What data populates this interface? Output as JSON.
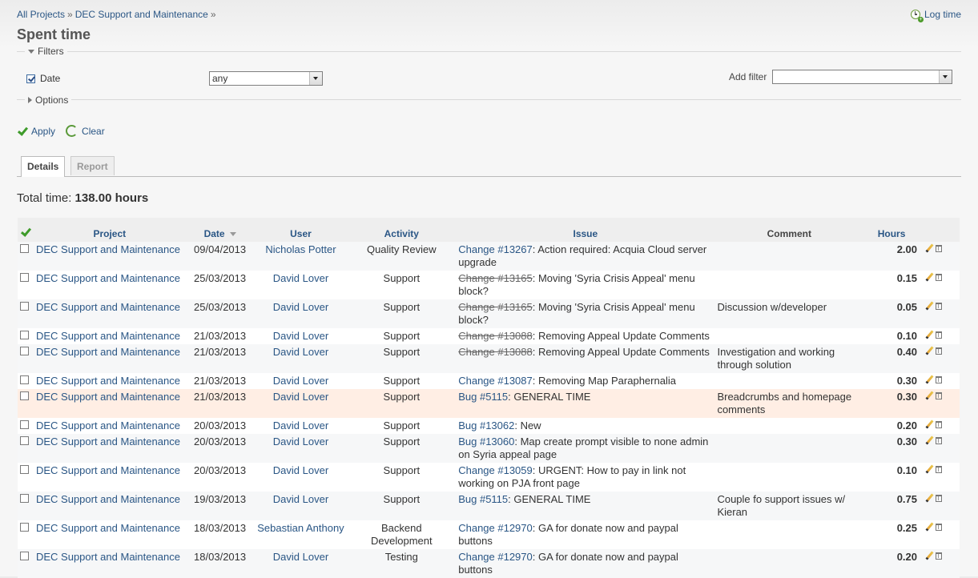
{
  "breadcrumb": {
    "all_projects": "All Projects",
    "project": "DEC Support and Maintenance",
    "sep": "»"
  },
  "log_time": "Log time",
  "title": "Spent time",
  "filters": {
    "legend": "Filters",
    "date_label": "Date",
    "date_value": "any",
    "add_filter_label": "Add filter",
    "add_filter_value": ""
  },
  "options": {
    "legend": "Options"
  },
  "actions": {
    "apply": "Apply",
    "clear": "Clear"
  },
  "tabs": {
    "details": "Details",
    "report": "Report"
  },
  "total": {
    "label": "Total time:",
    "value": "138.00 hours"
  },
  "table": {
    "headers": {
      "project": "Project",
      "date": "Date",
      "user": "User",
      "activity": "Activity",
      "issue": "Issue",
      "comment": "Comment",
      "hours": "Hours"
    },
    "rows": [
      {
        "project": "DEC Support and Maintenance",
        "date": "09/04/2013",
        "user": "Nicholas Potter",
        "activity": "Quality Review",
        "issue_ref": "Change #13267",
        "issue_closed": false,
        "issue_text": ": Action required: Acquia Cloud server upgrade",
        "comment": "",
        "hours": "2.00"
      },
      {
        "project": "DEC Support and Maintenance",
        "date": "25/03/2013",
        "user": "David Lover",
        "activity": "Support",
        "issue_ref": "Change #13165",
        "issue_closed": true,
        "issue_text": ": Moving 'Syria Crisis Appeal' menu block?",
        "comment": "",
        "hours": "0.15"
      },
      {
        "project": "DEC Support and Maintenance",
        "date": "25/03/2013",
        "user": "David Lover",
        "activity": "Support",
        "issue_ref": "Change #13165",
        "issue_closed": true,
        "issue_text": ": Moving 'Syria Crisis Appeal' menu block?",
        "comment": "Discussion w/developer",
        "hours": "0.05"
      },
      {
        "project": "DEC Support and Maintenance",
        "date": "21/03/2013",
        "user": "David Lover",
        "activity": "Support",
        "issue_ref": "Change #13088",
        "issue_closed": true,
        "issue_text": ": Removing Appeal Update Comments",
        "comment": "",
        "hours": "0.10"
      },
      {
        "project": "DEC Support and Maintenance",
        "date": "21/03/2013",
        "user": "David Lover",
        "activity": "Support",
        "issue_ref": "Change #13088",
        "issue_closed": true,
        "issue_text": ": Removing Appeal Update Comments",
        "comment": "Investigation and working through solution",
        "hours": "0.40"
      },
      {
        "project": "DEC Support and Maintenance",
        "date": "21/03/2013",
        "user": "David Lover",
        "activity": "Support",
        "issue_ref": "Change #13087",
        "issue_closed": false,
        "issue_text": ": Removing Map Paraphernalia",
        "comment": "",
        "hours": "0.30"
      },
      {
        "project": "DEC Support and Maintenance",
        "date": "21/03/2013",
        "user": "David Lover",
        "activity": "Support",
        "issue_ref": "Bug #5115",
        "issue_closed": false,
        "issue_text": ": GENERAL TIME",
        "comment": "Breadcrumbs and homepage comments",
        "hours": "0.30",
        "highlight": true
      },
      {
        "project": "DEC Support and Maintenance",
        "date": "20/03/2013",
        "user": "David Lover",
        "activity": "Support",
        "issue_ref": "Bug #13062",
        "issue_closed": false,
        "issue_text": ": New",
        "comment": "",
        "hours": "0.20"
      },
      {
        "project": "DEC Support and Maintenance",
        "date": "20/03/2013",
        "user": "David Lover",
        "activity": "Support",
        "issue_ref": "Bug #13060",
        "issue_closed": false,
        "issue_text": ": Map create prompt visible to none admin on Syria appeal page",
        "comment": "",
        "hours": "0.30"
      },
      {
        "project": "DEC Support and Maintenance",
        "date": "20/03/2013",
        "user": "David Lover",
        "activity": "Support",
        "issue_ref": "Change #13059",
        "issue_closed": false,
        "issue_text": ": URGENT: How to pay in link not working on PJA front page",
        "comment": "",
        "hours": "0.10"
      },
      {
        "project": "DEC Support and Maintenance",
        "date": "19/03/2013",
        "user": "David Lover",
        "activity": "Support",
        "issue_ref": "Bug #5115",
        "issue_closed": false,
        "issue_text": ": GENERAL TIME",
        "comment": "Couple fo support issues w/ Kieran",
        "hours": "0.75"
      },
      {
        "project": "DEC Support and Maintenance",
        "date": "18/03/2013",
        "user": "Sebastian Anthony",
        "activity": "Backend Development",
        "issue_ref": "Change #12970",
        "issue_closed": false,
        "issue_text": ": GA for donate now and paypal buttons",
        "comment": "",
        "hours": "0.25"
      },
      {
        "project": "DEC Support and Maintenance",
        "date": "18/03/2013",
        "user": "David Lover",
        "activity": "Testing",
        "issue_ref": "Change #12970",
        "issue_closed": false,
        "issue_text": ": GA for donate now and paypal buttons",
        "comment": "",
        "hours": "0.20"
      }
    ]
  }
}
